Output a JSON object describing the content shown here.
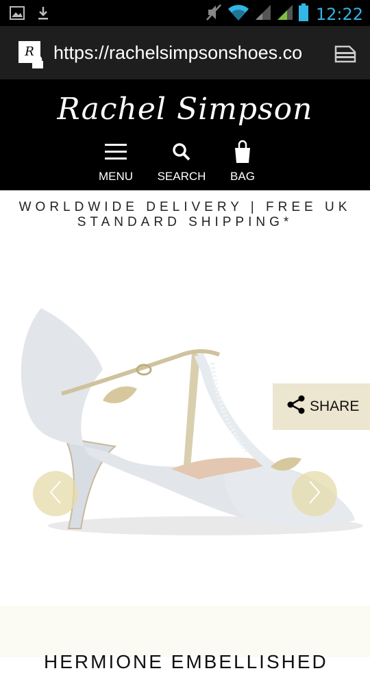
{
  "status_bar": {
    "time": "12:22",
    "icons": [
      "image-icon",
      "download-icon",
      "mute-icon",
      "wifi-icon",
      "signal-icon",
      "signal-icon",
      "battery-icon"
    ]
  },
  "browser": {
    "url": "https://rachelsimpsonshoes.co",
    "favicon_letter": "R"
  },
  "header": {
    "logo": "Rachel Simpson",
    "nav": [
      {
        "label": "MENU"
      },
      {
        "label": "SEARCH"
      },
      {
        "label": "BAG"
      }
    ]
  },
  "promo": {
    "text": "WORLDWIDE DELIVERY | FREE UK STANDARD SHIPPING*"
  },
  "product": {
    "share_label": "SHARE",
    "title_partial": "HERMIONE EMBELLISHED"
  },
  "colors": {
    "status_accent": "#33b5e5",
    "header_bg": "#000000",
    "share_bg": "#ece5cf",
    "arrow_bg": "#e6dbaa"
  }
}
